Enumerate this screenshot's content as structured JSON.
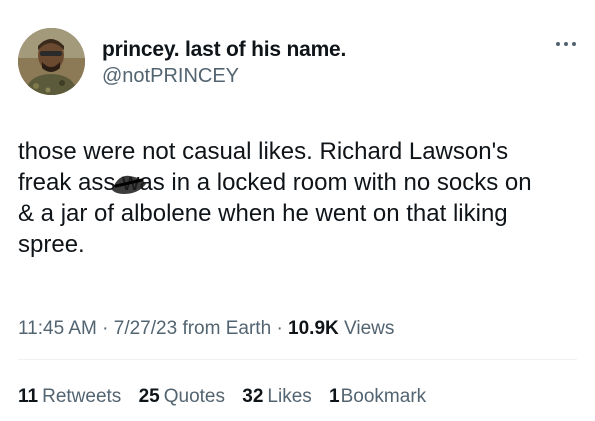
{
  "author": {
    "display_name": "princey. last of his name.",
    "handle": "@notPRINCEY",
    "avatar_icon": "profile-photo"
  },
  "more_icon": "ellipsis-icon",
  "tweet": {
    "lines": [
      "those were not casual likes. Richard Lawson's",
      "freak ass was in a locked room with no socks on",
      "& a jar of albolene when he went on that liking",
      "spree."
    ]
  },
  "meta": {
    "time": "11:45 AM",
    "sep1": "·",
    "date": "7/27/23",
    "source": "from Earth",
    "sep2": "·",
    "views_count": "10.9K",
    "views_label": "Views"
  },
  "stats": {
    "retweets_count": "11",
    "retweets_label": "Retweets",
    "quotes_count": "25",
    "quotes_label": "Quotes",
    "likes_count": "32",
    "likes_label": "Likes",
    "bookmarks_count": "1",
    "bookmarks_label": "Bookmark"
  },
  "colors": {
    "text": "#0f1419",
    "secondary": "#536471",
    "divider": "#eff3f4",
    "background": "#ffffff"
  }
}
